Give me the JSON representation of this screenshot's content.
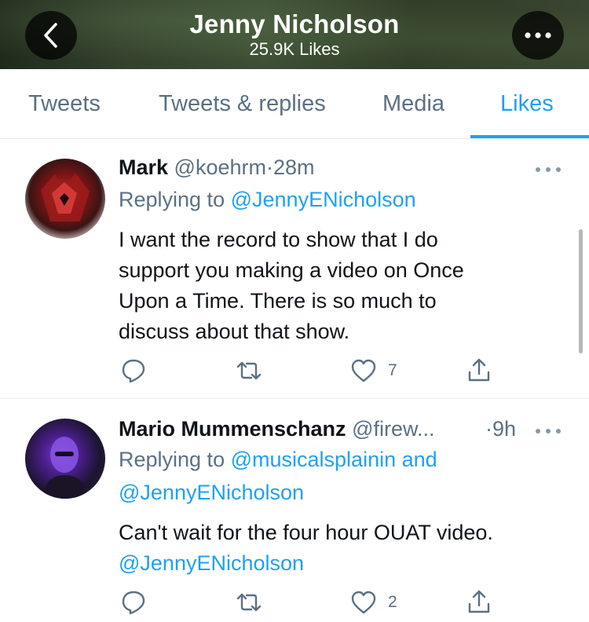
{
  "header": {
    "title": "Jenny Nicholson",
    "subtitle": "25.9K Likes",
    "back_icon": "chevron-left-icon",
    "more_icon": "ellipsis-icon"
  },
  "tabs": [
    {
      "label": "Tweets"
    },
    {
      "label": "Tweets & replies"
    },
    {
      "label": "Media"
    },
    {
      "label": "Likes",
      "active": true
    }
  ],
  "tweets": [
    {
      "name": "Mark",
      "handle": "@koehrm",
      "separator": "·",
      "time": "28m",
      "replying_prefix": "Replying to",
      "replying_to": "@JennyENicholson",
      "body_lines": [
        "I want the record to show that I do",
        "support you making a video on Once",
        "Upon a Time. There is so much to",
        "discuss about that show."
      ],
      "likes": "7"
    },
    {
      "name": "Mario Mummenschanz",
      "handle": "@firew...",
      "separator": "·",
      "time": "9h",
      "replying_prefix": "Replying to",
      "replying_to": "@musicalsplainin",
      "replying_and": "and",
      "replying_to_2": "@JennyENicholson",
      "body_lines": [
        "Can't wait for the four hour OUAT video."
      ],
      "body_mention": "@JennyENicholson",
      "likes": "2"
    }
  ],
  "colors": {
    "accent": "#1da1f2",
    "muted": "#5b7083",
    "text": "#0f1419",
    "border": "#e6ecf0"
  }
}
